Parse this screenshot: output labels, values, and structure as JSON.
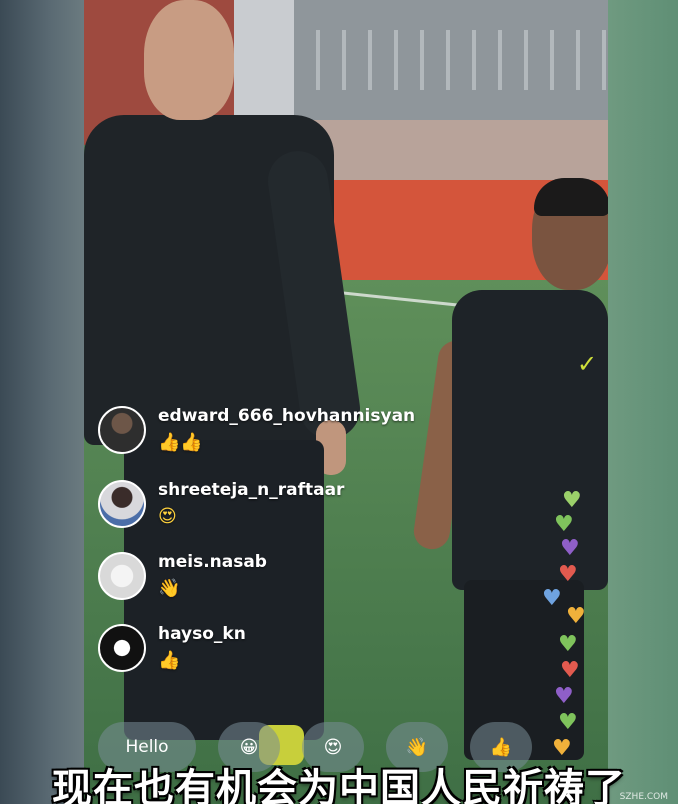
{
  "live_stream": {
    "comments": [
      {
        "username": "edward_666_hovhannisyan",
        "reaction": "👍👍"
      },
      {
        "username": "shreeteja_n_raftaar",
        "reaction": "😍"
      },
      {
        "username": "meis.nasab",
        "reaction": "👋"
      },
      {
        "username": "hayso_kn",
        "reaction": "👍"
      }
    ],
    "quick_reactions": [
      {
        "label": "Hello"
      },
      {
        "label": "😀"
      },
      {
        "label": "😍"
      },
      {
        "label": "👋"
      },
      {
        "label": "👍"
      }
    ]
  },
  "subtitle": "现在也有机会为中国人民祈祷了",
  "watermark": "SZHE.COM",
  "colors": {
    "subtitle_text": "#ffffff",
    "subtitle_stroke": "#000000",
    "chip_bg": "rgba(120,140,150,.55)"
  }
}
